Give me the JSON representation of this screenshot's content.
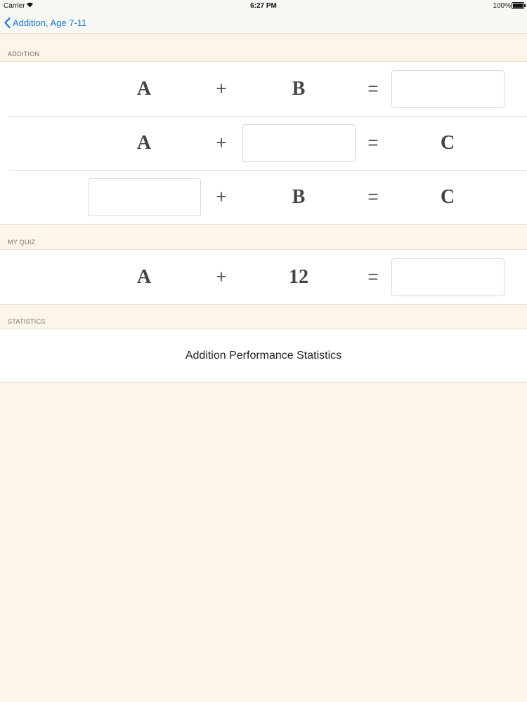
{
  "status_bar": {
    "carrier": "Carrier",
    "time": "6:27 PM",
    "battery": "100%"
  },
  "nav": {
    "back_label": "Addition, Age 7-11"
  },
  "sections": {
    "addition": "ADDITION",
    "my_quiz": "MY QUIZ",
    "statistics": "STATISTICS"
  },
  "addition_rows": [
    {
      "a": "A",
      "op": "+",
      "b": "B",
      "eq": "=",
      "c": ""
    },
    {
      "a": "A",
      "op": "+",
      "b": "",
      "eq": "=",
      "c": "C"
    },
    {
      "a": "",
      "op": "+",
      "b": "B",
      "eq": "=",
      "c": "C"
    }
  ],
  "quiz_row": {
    "a": "A",
    "op": "+",
    "b": "12",
    "eq": "=",
    "c": ""
  },
  "statistics_label": "Addition Performance Statistics",
  "colors": {
    "background": "#fdf6e8",
    "accent": "#1479d6",
    "cell": "#ffffff"
  },
  "icons": {
    "back": "chevron-left-icon",
    "wifi": "wifi-icon",
    "battery": "battery-icon"
  }
}
